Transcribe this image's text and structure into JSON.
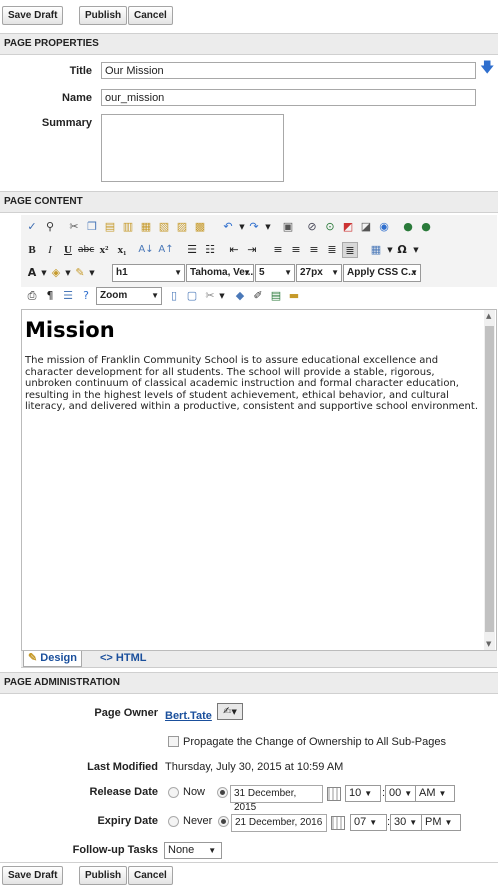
{
  "toolbar": {
    "save_draft": "Save Draft",
    "publish": "Publish",
    "cancel": "Cancel"
  },
  "properties": {
    "header": "PAGE PROPERTIES",
    "title_label": "Title",
    "title_value": "Our Mission",
    "name_label": "Name",
    "name_value": "our_mission",
    "summary_label": "Summary",
    "summary_value": ""
  },
  "content": {
    "header": "PAGE CONTENT",
    "format_select": "h1",
    "font_select": "Tahoma, Ve...",
    "size_select": "5",
    "px_select": "27px",
    "css_select": "Apply CSS C...",
    "zoom_select": "Zoom",
    "heading": "Mission",
    "paragraph": "The mission of Franklin Community School is to assure educational excellence and character development for all students. The school will provide a stable, rigorous, unbroken continuum of classical academic instruction and formal character education, resulting in the highest levels of student achievement, ethical behavior, and cultural literacy, and delivered within a productive, consistent and supportive school environment.",
    "tab_design": "Design",
    "tab_html": "HTML"
  },
  "admin": {
    "header": "PAGE ADMINISTRATION",
    "owner_label": "Page Owner",
    "owner_value": "Bert.Tate",
    "propagate_label": "Propagate the Change of Ownership to All Sub-Pages",
    "modified_label": "Last Modified",
    "modified_value": "Thursday, July 30, 2015 at 10:59 AM",
    "release_label": "Release Date",
    "release_now": "Now",
    "release_date": "31 December, 2015",
    "release_hour": "10",
    "release_min": "00",
    "release_ampm": "AM",
    "expiry_label": "Expiry Date",
    "expiry_never": "Never",
    "expiry_date": "21 December, 2016",
    "expiry_hour": "07",
    "expiry_min": "30",
    "expiry_ampm": "PM",
    "followup_label": "Follow-up Tasks",
    "followup_value": "None"
  }
}
